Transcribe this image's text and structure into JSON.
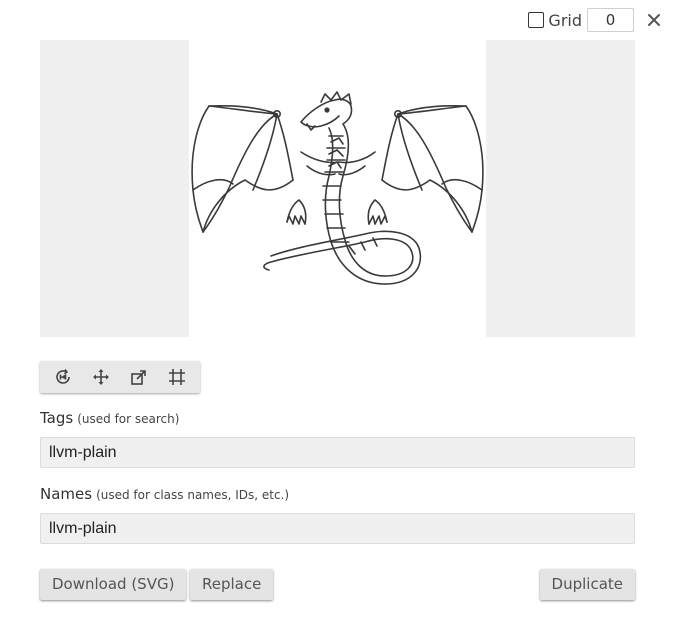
{
  "topbar": {
    "grid_label": "Grid",
    "grid_value": "0",
    "close_icon": "close-icon"
  },
  "preview": {
    "image_icon": "dragon-icon",
    "background_color": "#f0f0f0"
  },
  "toolbar": {
    "tools": [
      "rotate-icon",
      "move-icon",
      "scale-icon",
      "crop-icon"
    ]
  },
  "tags": {
    "label": "Tags",
    "hint": "(used for search)",
    "value": "llvm-plain"
  },
  "names": {
    "label": "Names",
    "hint": "(used for class names, IDs, etc.)",
    "value": "llvm-plain"
  },
  "buttons": {
    "download": "Download (SVG)",
    "replace": "Replace",
    "duplicate": "Duplicate"
  }
}
